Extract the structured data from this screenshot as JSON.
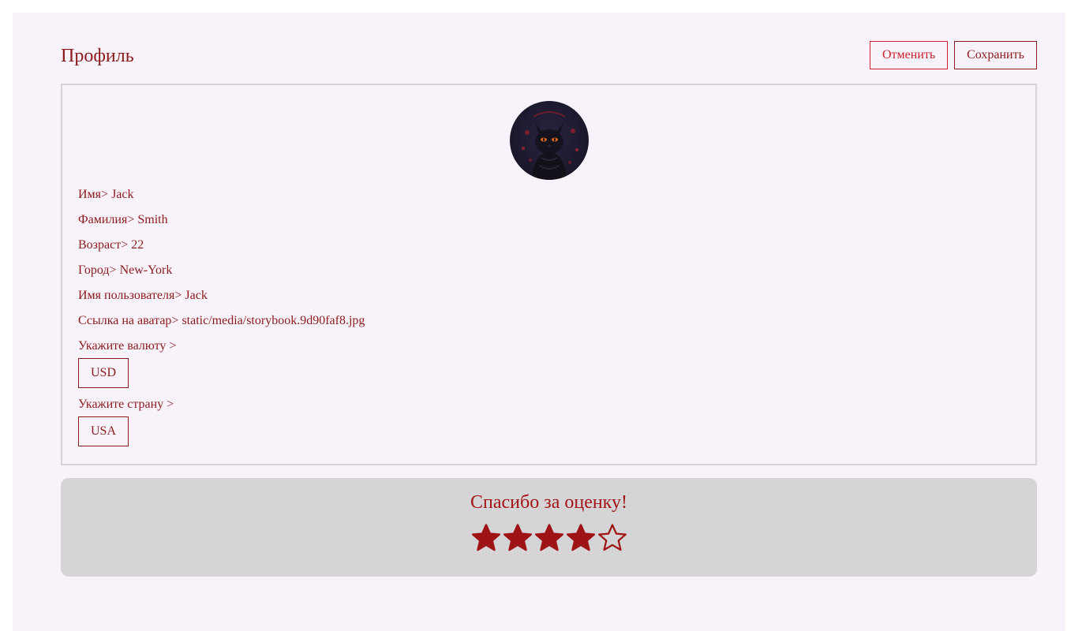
{
  "header": {
    "title": "Профиль",
    "cancel_label": "Отменить",
    "save_label": "Сохранить"
  },
  "profile": {
    "avatar_alt": "cat-avatar",
    "fields": [
      {
        "label": "Имя",
        "value": "Jack"
      },
      {
        "label": "Фамилия",
        "value": "Smith"
      },
      {
        "label": "Возраст",
        "value": "22"
      },
      {
        "label": "Город",
        "value": "New-York"
      },
      {
        "label": "Имя пользователя",
        "value": "Jack"
      },
      {
        "label": "Ссылка на аватар",
        "value": "static/media/storybook.9d90faf8.jpg"
      }
    ],
    "separator": ">",
    "currency_label": "Укажите валюту >",
    "currency_value": "USD",
    "country_label": "Укажите страну >",
    "country_value": "USA"
  },
  "rating": {
    "title": "Спасибо за оценку!",
    "value": 4,
    "max": 5
  },
  "colors": {
    "accent": "#8b1a1a",
    "cancel": "#cc1f2a",
    "star": "#9e1414",
    "page_bg": "#f8f3fa",
    "rating_bg": "#d5d4d7"
  },
  "icons": {
    "star_filled": "star-filled-icon",
    "star_empty": "star-outline-icon"
  }
}
